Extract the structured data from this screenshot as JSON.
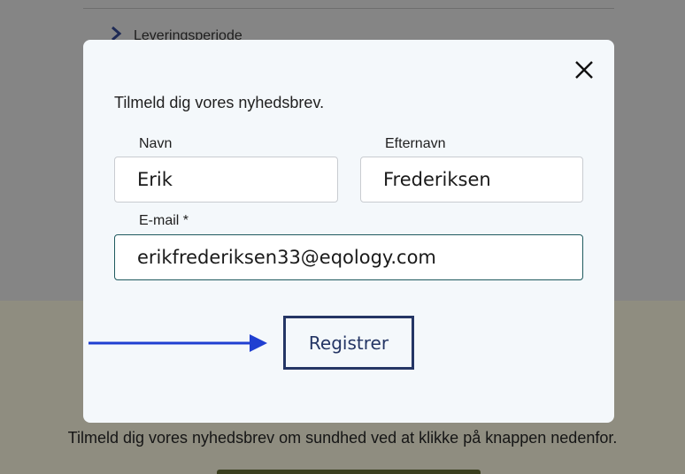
{
  "background": {
    "accordion_label": "Leveringsperiode",
    "newsletter_text": "Tilmeld dig vores nyhedsbrev om sundhed ved at klikke på knappen nedenfor."
  },
  "modal": {
    "title": "Tilmeld dig vores nyhedsbrev.",
    "close_icon": "close-icon",
    "first_name": {
      "label": "Navn",
      "value": "Erik"
    },
    "last_name": {
      "label": "Efternavn",
      "value": "Frederiksen"
    },
    "email": {
      "label": "E-mail *",
      "value": "erikfrederiksen33@eqology.com"
    },
    "register_label": "Registrer"
  },
  "annotation": {
    "icon": "arrow-right-icon",
    "color": "#1f3fd1"
  },
  "colors": {
    "button_border": "#253665",
    "focus_border": "#1f5a5f"
  }
}
